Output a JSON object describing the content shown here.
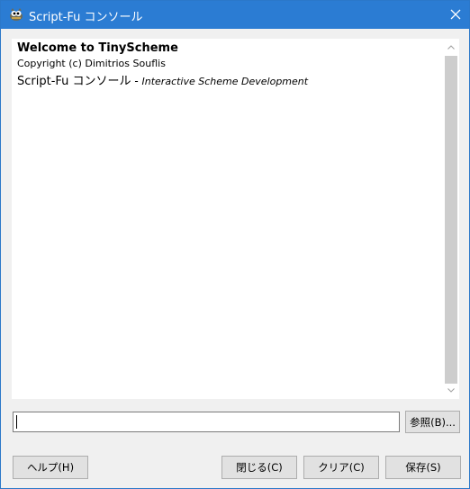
{
  "window": {
    "title": "Script-Fu コンソール",
    "app_icon": "gimp-wilber-icon",
    "close_icon": "close-icon"
  },
  "console": {
    "welcome": "Welcome to TinyScheme",
    "copyright": "Copyright (c) Dimitrios Souflis",
    "scriptfu_name": "Script-Fu コンソール",
    "separator": " - ",
    "description": "Interactive Scheme Development"
  },
  "input": {
    "value": "",
    "placeholder": ""
  },
  "buttons": {
    "browse": "参照(B)...",
    "help": "ヘルプ(H)",
    "close": "閉じる(C)",
    "clear": "クリア(C)",
    "save": "保存(S)"
  },
  "colors": {
    "titlebar": "#2b7cd3",
    "button_bg": "#e1e1e1",
    "scroll_thumb": "#cdcdcd"
  }
}
